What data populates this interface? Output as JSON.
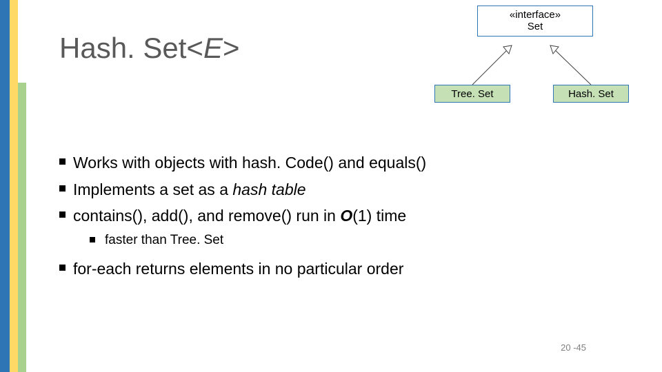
{
  "title": {
    "base": "Hash. Set<",
    "generic": "E",
    "tail": ">"
  },
  "diagram": {
    "interface": {
      "stereotype": "«interface»",
      "name": "Set"
    },
    "treeset": "Tree. Set",
    "hashset": "Hash. Set"
  },
  "bullets": {
    "b1": "Works with objects with hash. Code() and equals()",
    "b2a": "Implements a set as a ",
    "b2b": "hash table",
    "b3a": "contains(), add(), and remove() run in ",
    "b3b": "O",
    "b3c": "(1) time",
    "sub1": "faster than Tree. Set",
    "b4": "for-each returns elements in no particular order"
  },
  "pageno": "20 -45"
}
